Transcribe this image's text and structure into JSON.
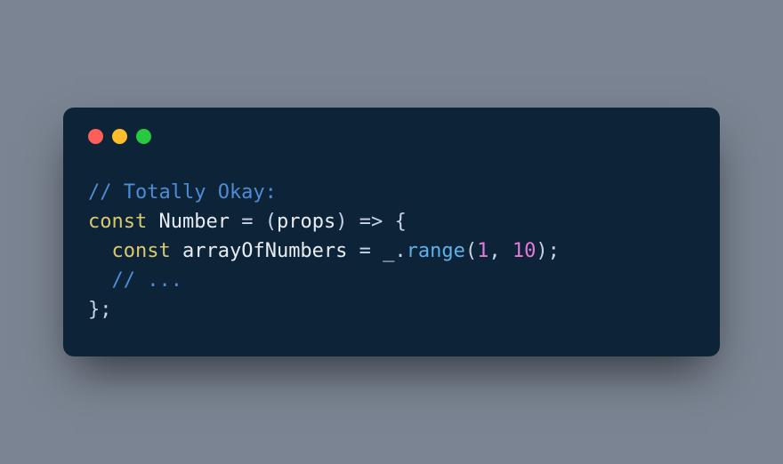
{
  "colors": {
    "background": "#7b8492",
    "window": "#0d2438",
    "red": "#ff5f56",
    "yellow": "#ffbd2e",
    "green": "#27c93f"
  },
  "code": {
    "line1": {
      "comment": "// Totally Okay:"
    },
    "line2": {
      "keyword": "const",
      "space1": " ",
      "name": "Number",
      "space2": " ",
      "equals": "=",
      "space3": " ",
      "paren_open": "(",
      "param": "props",
      "paren_close": ")",
      "space4": " ",
      "arrow": "=>",
      "space5": " ",
      "brace_open": "{"
    },
    "line3": {
      "indent": "  ",
      "keyword": "const",
      "space1": " ",
      "name": "arrayOfNumbers",
      "space2": " ",
      "equals": "=",
      "space3": " ",
      "underscore": "_",
      "dot": ".",
      "method": "range",
      "paren_open": "(",
      "num1": "1",
      "comma": ",",
      "space4": " ",
      "num2": "10",
      "paren_close": ")",
      "semi": ";"
    },
    "line4": {
      "indent": "  ",
      "comment": "// ..."
    },
    "line5": {
      "brace_close": "}",
      "semi": ";"
    }
  }
}
